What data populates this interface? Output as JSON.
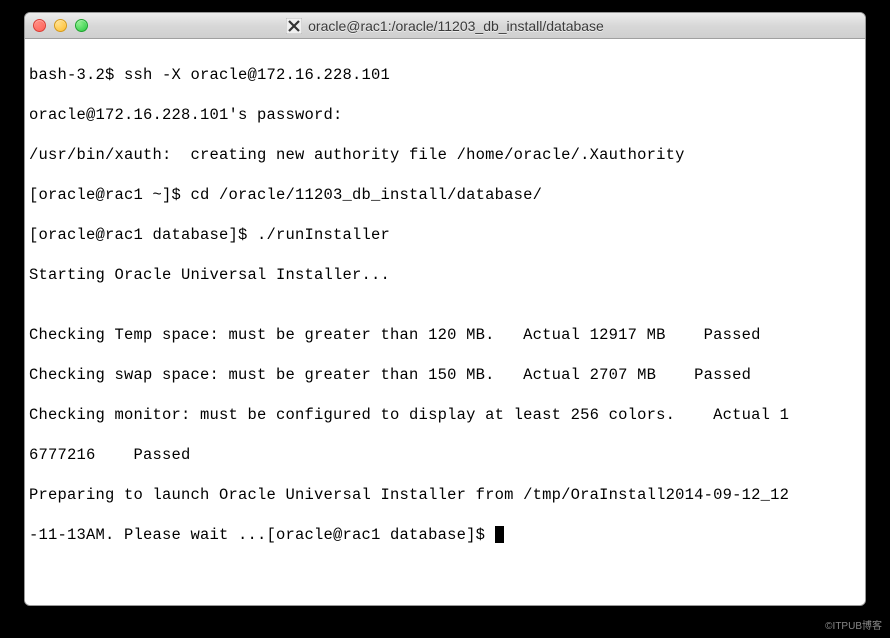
{
  "window": {
    "title": "oracle@rac1:/oracle/11203_db_install/database"
  },
  "terminal": {
    "lines": [
      "bash-3.2$ ssh -X oracle@172.16.228.101",
      "oracle@172.16.228.101's password:",
      "/usr/bin/xauth:  creating new authority file /home/oracle/.Xauthority",
      "[oracle@rac1 ~]$ cd /oracle/11203_db_install/database/",
      "[oracle@rac1 database]$ ./runInstaller",
      "Starting Oracle Universal Installer...",
      "",
      "Checking Temp space: must be greater than 120 MB.   Actual 12917 MB    Passed",
      "Checking swap space: must be greater than 150 MB.   Actual 2707 MB    Passed",
      "Checking monitor: must be configured to display at least 256 colors.    Actual 1",
      "6777216    Passed",
      "Preparing to launch Oracle Universal Installer from /tmp/OraInstall2014-09-12_12"
    ],
    "last_line_prefix": "-11-13AM. Please wait ...[oracle@rac1 database]$ "
  },
  "watermark": "©ITPUB博客"
}
